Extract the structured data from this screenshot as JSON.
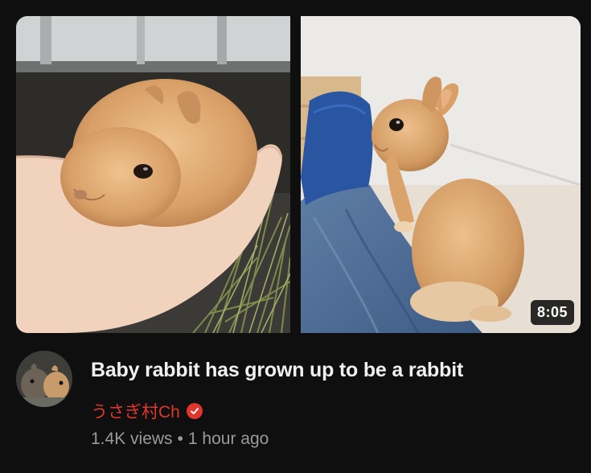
{
  "video": {
    "duration": "8:05",
    "title": "Baby rabbit has grown up to be a rabbit",
    "channel": "うさぎ村Ch",
    "views": "1.4K views",
    "separator": "•",
    "age": "1 hour ago"
  },
  "colors": {
    "background": "#0f0f0f",
    "title": "#f1f1f1",
    "channel": "#e0362c",
    "meta": "#9a9a9a"
  },
  "icons": {
    "verified": "verified-check-icon"
  }
}
